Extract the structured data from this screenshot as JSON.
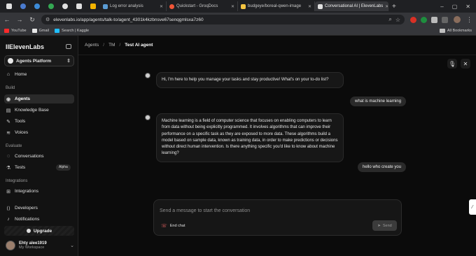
{
  "browser": {
    "tabs": [
      {
        "title": "Log error analysis",
        "color": "#5a9bd4"
      },
      {
        "title": "Quickstart - GroqDocs",
        "color": "#f05537"
      },
      {
        "title": "budgeye/boreal-qwen-image",
        "color": "#f5c542"
      },
      {
        "title": "Conversational AI | ElevenLabs",
        "color": "#e0e0e0",
        "active": true
      }
    ],
    "mini_tab_colors": [
      "#e0e0e0",
      "#4a7bd0",
      "#3c8bd8",
      "#34a853",
      "#e0e0e0",
      "#e0e0e0",
      "#e0e0e0"
    ],
    "new_tab": "+",
    "url": "elevenlabs.io/app/agents/talk-to/agent_4301k4kzbnsve67senqgmlsxa7z60",
    "bookmarks": [
      {
        "label": "YouTube",
        "color": "#ff2a2a"
      },
      {
        "label": "Gmail",
        "color": "#e8e8e8"
      },
      {
        "label": "Search | Kaggle",
        "color": "#20beff"
      }
    ],
    "all_bookmarks": "All Bookmarks"
  },
  "sidebar": {
    "brand": "IIElevenLabs",
    "platform": "Agents Platform",
    "home": "Home",
    "section_build": "Build",
    "agents": "Agents",
    "knowledge_base": "Knowledge Base",
    "tools": "Tools",
    "voices": "Voices",
    "section_evaluate": "Evaluate",
    "conversations": "Conversations",
    "tests": "Tests",
    "tests_badge": "Alpha",
    "section_integrations": "Integrations",
    "integrations": "Integrations",
    "developers": "Developers",
    "notifications": "Notifications",
    "upgrade": "Upgrade",
    "user_name": "Ehty alee1919",
    "workspace": "My Workspace"
  },
  "breadcrumb": {
    "agents": "Agents",
    "tm": "TM",
    "current": "Test AI agent"
  },
  "chat": {
    "agent_greeting": "Hi, I'm here to help you manage your tasks and stay productive! What's on your to-do list?",
    "user_q1": "what is machine learning",
    "agent_answer": "Machine learning is a field of computer science that focuses on enabling computers to learn from data without being explicitly programmed. It involves algorithms that can improve their performance on a specific task as they are exposed to more data. These algorithms build a model based on sample data, known as training data, in order to make predictions or decisions without direct human intervention. Is there anything specific you'd like to know about machine learning?",
    "user_q2": "hello who create you"
  },
  "composer": {
    "placeholder": "Send a message to start the conversation",
    "end_chat": "End chat",
    "send": "Send"
  }
}
